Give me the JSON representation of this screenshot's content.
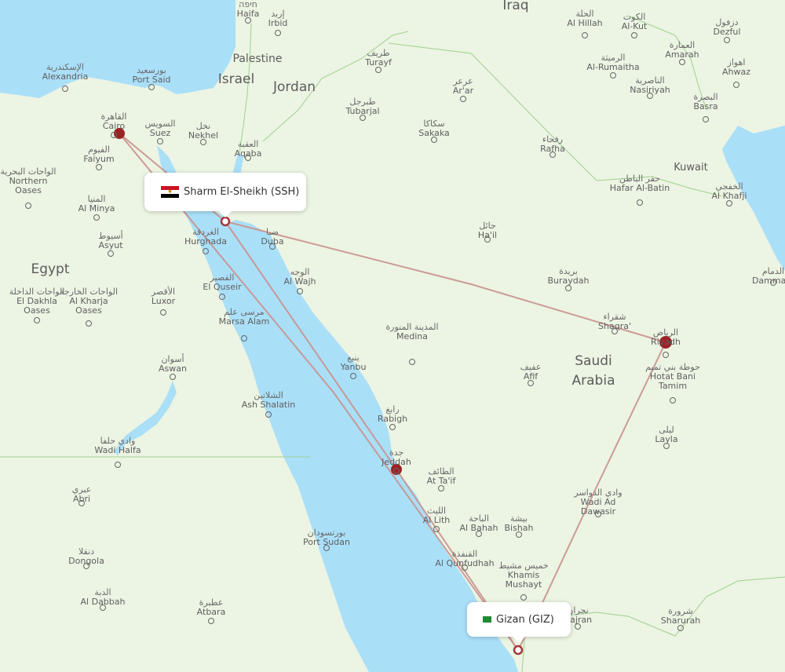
{
  "map": {
    "colors": {
      "land": "#ecf4e3",
      "water": "#aadff8",
      "border": "#9fd18f",
      "route": "#c9918d",
      "hub": "#9b2226",
      "marker": "#a3373a"
    },
    "countries": [
      "Iraq",
      "Palestine",
      "Israel",
      "Jordan",
      "Egypt",
      "Saudi Arabia",
      "Kuwait"
    ],
    "cities": [
      {
        "en": "Haifa",
        "ar": "חיפה"
      },
      {
        "en": "Irbid",
        "ar": "إربد"
      },
      {
        "en": "Alexandria",
        "ar": "الإسكندرية"
      },
      {
        "en": "Port Said",
        "ar": "بورسعيد"
      },
      {
        "en": "Cairo",
        "ar": "القاهرة"
      },
      {
        "en": "Suez",
        "ar": "السويس"
      },
      {
        "en": "Nekhel",
        "ar": "نخل"
      },
      {
        "en": "Aqaba",
        "ar": "العقبة"
      },
      {
        "en": "Faiyum",
        "ar": "الفيوم"
      },
      {
        "en": "Northern Oases",
        "ar": "الواحات البحرية"
      },
      {
        "en": "Al Minya",
        "ar": "المنيا"
      },
      {
        "en": "Asyut",
        "ar": "أسيوط"
      },
      {
        "en": "Hurghada",
        "ar": "الغردقة"
      },
      {
        "en": "El Quseir",
        "ar": "القصير"
      },
      {
        "en": "Marsa Alam",
        "ar": "مرسى علم"
      },
      {
        "en": "Luxor",
        "ar": "الأقصر"
      },
      {
        "en": "El Dakhla Oases",
        "ar": "الواحات الداخلة"
      },
      {
        "en": "Al Kharja Oases",
        "ar": "الواحات الخارجة"
      },
      {
        "en": "Aswan",
        "ar": "أسوان"
      },
      {
        "en": "Ash Shalatin",
        "ar": "الشلاتين"
      },
      {
        "en": "Wadi Halfa",
        "ar": "وادي حلفا"
      },
      {
        "en": "Abri",
        "ar": "عبري"
      },
      {
        "en": "Dongola",
        "ar": "دنقلا"
      },
      {
        "en": "Al Dabbah",
        "ar": "الدبة"
      },
      {
        "en": "Atbara",
        "ar": "عطبرة"
      },
      {
        "en": "Port Sudan",
        "ar": "بورتسودان"
      },
      {
        "en": "Turayf",
        "ar": "طريف"
      },
      {
        "en": "Tubarjal",
        "ar": "طبرجل"
      },
      {
        "en": "Ar'ar",
        "ar": "عرعر"
      },
      {
        "en": "Sakaka",
        "ar": "سكاكا"
      },
      {
        "en": "Rafha",
        "ar": "رفحاء"
      },
      {
        "en": "Duba",
        "ar": "ضبا"
      },
      {
        "en": "Al Wajh",
        "ar": "الوجه"
      },
      {
        "en": "Ha'il",
        "ar": "حائل"
      },
      {
        "en": "Buraydah",
        "ar": "بريدة"
      },
      {
        "en": "Shaqra'",
        "ar": "شقراء"
      },
      {
        "en": "Riyadh",
        "ar": "الرياض"
      },
      {
        "en": "Medina",
        "ar": "المدينة المنورة"
      },
      {
        "en": "Yanbu",
        "ar": "ينبع"
      },
      {
        "en": "Afif",
        "ar": "عفيف"
      },
      {
        "en": "Hotat Bani Tamim",
        "ar": "حوطة بني تميم"
      },
      {
        "en": "Rabigh",
        "ar": "رابغ"
      },
      {
        "en": "Jeddah",
        "ar": "جدة"
      },
      {
        "en": "At Ta'if",
        "ar": "الطائف"
      },
      {
        "en": "Layla",
        "ar": "ليلى"
      },
      {
        "en": "Wadi Ad Dawasir",
        "ar": "وادي الدواسر"
      },
      {
        "en": "Al Lith",
        "ar": "الليث"
      },
      {
        "en": "Al Bahah",
        "ar": "الباحة"
      },
      {
        "en": "Bishah",
        "ar": "بيشة"
      },
      {
        "en": "Al Qunfudhah",
        "ar": "القنفذة"
      },
      {
        "en": "Khamis Mushayt",
        "ar": "خميس مشيط"
      },
      {
        "en": "Najran",
        "ar": "نجران"
      },
      {
        "en": "Sharurah",
        "ar": "شرورة"
      },
      {
        "en": "Al Hillah",
        "ar": "الحلة"
      },
      {
        "en": "Al-Kut",
        "ar": "الكوت"
      },
      {
        "en": "Dezful",
        "ar": "دزفول"
      },
      {
        "en": "Amarah",
        "ar": "العمارة"
      },
      {
        "en": "Al-Rumaitha",
        "ar": "الرميثة"
      },
      {
        "en": "Ahwaz",
        "ar": "اهواز"
      },
      {
        "en": "Nasiriyah",
        "ar": "الناصرية"
      },
      {
        "en": "Basra",
        "ar": "البصرة"
      },
      {
        "en": "Hafar Al-Batin",
        "ar": "حفر الباطن"
      },
      {
        "en": "Al Khafji",
        "ar": "الخفجي"
      },
      {
        "en": "Dammam",
        "ar": "الدمام"
      }
    ],
    "hubs": [
      "Cairo",
      "Riyadh",
      "Jeddah"
    ],
    "routes": [
      {
        "from": "Sharm El-Sheikh (SSH)",
        "to": "Cairo"
      },
      {
        "from": "Sharm El-Sheikh (SSH)",
        "to": "Riyadh"
      },
      {
        "from": "Sharm El-Sheikh (SSH)",
        "to": "Jeddah"
      },
      {
        "from": "Cairo",
        "to": "Gizan (GIZ)"
      },
      {
        "from": "Jeddah",
        "to": "Gizan (GIZ)"
      },
      {
        "from": "Riyadh",
        "to": "Gizan (GIZ)"
      }
    ]
  },
  "origin_popup": {
    "label": "Sharm El-Sheikh (SSH)",
    "flag": "egypt-flag"
  },
  "destination_popup": {
    "label": "Gizan (GIZ)",
    "flag": "saudi-flag"
  }
}
